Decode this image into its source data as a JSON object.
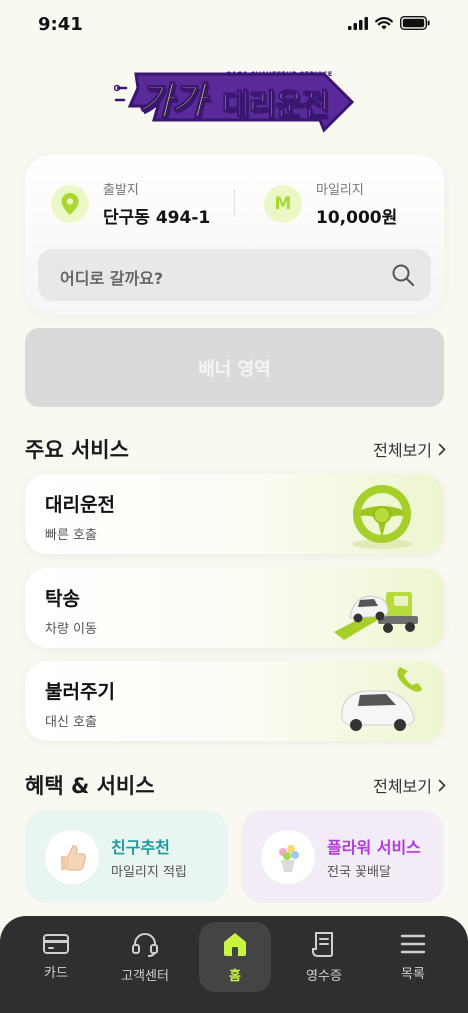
{
  "status": {
    "time": "9:41"
  },
  "logo": {
    "gaga": "가가",
    "main": "대리운전",
    "sub": "GAGA CHAUFFEUR SERVICE"
  },
  "info": {
    "departure_label": "출발지",
    "departure_value": "단구동 494-1",
    "mileage_icon": "M",
    "mileage_label": "마일리지",
    "mileage_value": "10,000원"
  },
  "search": {
    "placeholder": "어디로 갈까요?"
  },
  "banner": {
    "label": "배너 영역"
  },
  "main_services": {
    "title": "주요 서비스",
    "more": "전체보기",
    "items": [
      {
        "title": "대리운전",
        "subtitle": "빠른 호출",
        "icon": "steering-wheel-icon"
      },
      {
        "title": "탁송",
        "subtitle": "차량 이동",
        "icon": "tow-truck-icon"
      },
      {
        "title": "불러주기",
        "subtitle": "대신 호출",
        "icon": "car-phone-icon"
      }
    ]
  },
  "benefits": {
    "title": "혜택 & 서비스",
    "more": "전체보기",
    "items": [
      {
        "title": "친구추천",
        "subtitle": "마일리지 적립",
        "color": "#1f9aa3",
        "icon": "thumbs-up-icon"
      },
      {
        "title": "플라워 서비스",
        "subtitle": "전국 꽃배달",
        "color": "#b23be0",
        "icon": "flower-bouquet-icon"
      }
    ]
  },
  "tabs": [
    {
      "label": "카드",
      "icon": "card-icon"
    },
    {
      "label": "고객센터",
      "icon": "headset-icon"
    },
    {
      "label": "홈",
      "icon": "home-icon",
      "active": true
    },
    {
      "label": "영수증",
      "icon": "receipt-icon"
    },
    {
      "label": "목록",
      "icon": "menu-icon"
    }
  ],
  "colors": {
    "accent": "#c8f542",
    "brand_purple": "#3b1670",
    "tab_bar": "#2f2f2f"
  }
}
